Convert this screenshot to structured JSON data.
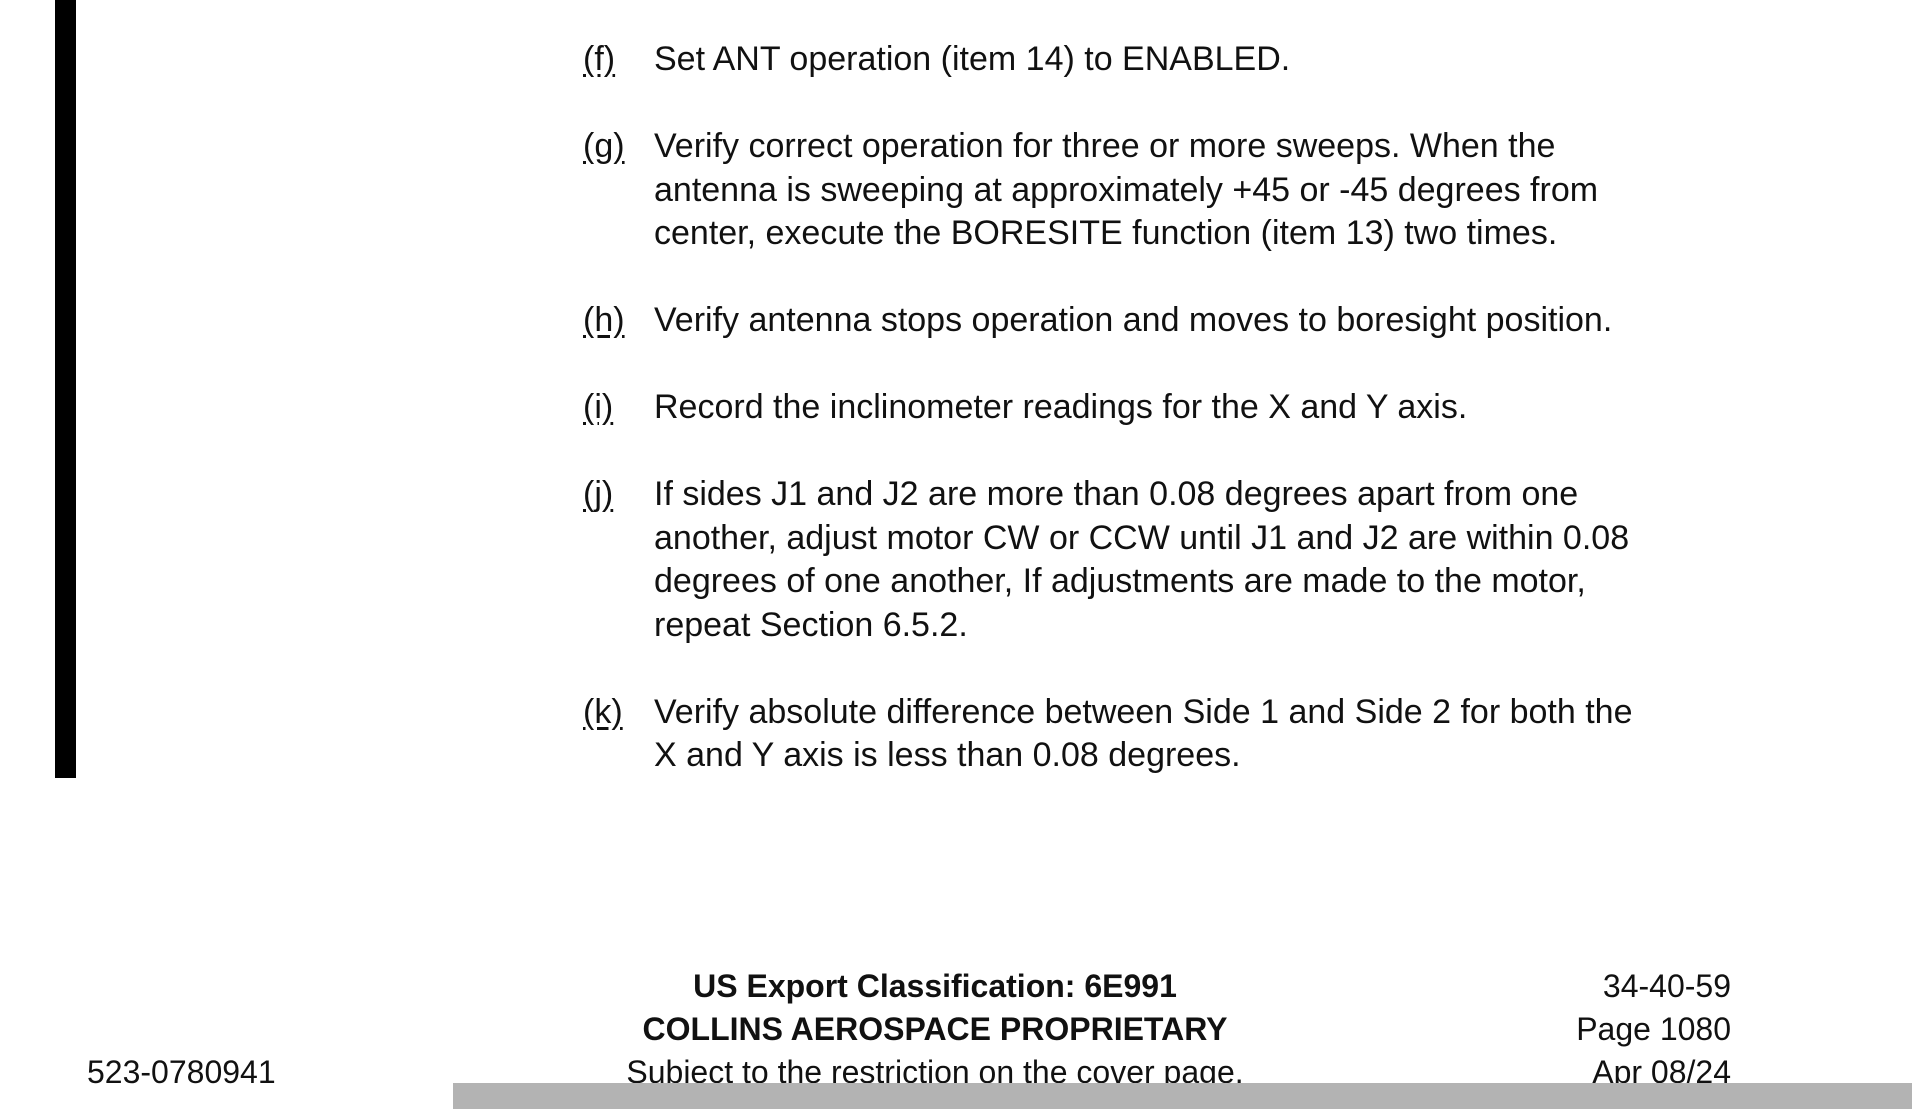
{
  "steps": [
    {
      "letter": "(f)",
      "lines": [
        "Set ANT operation (item 14) to ENABLED."
      ]
    },
    {
      "letter": "(g)",
      "lines": [
        "Verify correct operation for three or more sweeps.  When the",
        "antenna is sweeping at approximately +45 or -45 degrees from",
        "center, execute the BORESITE function (item 13) two times."
      ]
    },
    {
      "letter": "(h)",
      "lines": [
        "Verify antenna stops operation and moves to boresight position."
      ]
    },
    {
      "letter": "(i)",
      "lines": [
        "Record the inclinometer readings for the X and Y axis."
      ]
    },
    {
      "letter": "(j)",
      "lines": [
        "If sides J1 and J2 are more than 0.08 degrees apart from one",
        "another, adjust motor CW or CCW until J1 and J2 are within 0.08",
        "degrees of one another, If adjustments are made to the motor,",
        "repeat Section 6.5.2."
      ]
    },
    {
      "letter": "(k)",
      "lines": [
        "Verify absolute difference between Side 1 and Side 2 for both the",
        "X and Y axis is less than 0.08 degrees."
      ]
    }
  ],
  "footer": {
    "export_classification": "US Export Classification:  6E991",
    "proprietary": "COLLINS AEROSPACE PROPRIETARY",
    "restriction": "Subject to the restriction on the cover page.",
    "doc_number": "523-0780941",
    "ata_chapter": "34-40-59",
    "page": "Page 1080",
    "date": "Apr 08/24"
  }
}
